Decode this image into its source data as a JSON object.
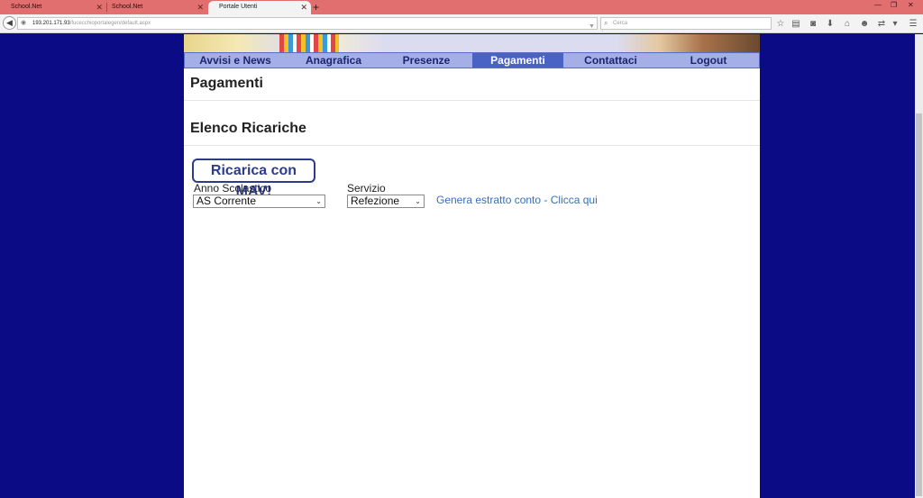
{
  "browser": {
    "tabs": [
      {
        "title": "School.Net"
      },
      {
        "title": "School.Net"
      },
      {
        "title": "Portale Utenti"
      }
    ],
    "url_host": "193.201.171.93",
    "url_path": "/fucecchioportalegen/default.aspx",
    "search_placeholder": "Cerca"
  },
  "menu": {
    "items": [
      {
        "label": "Avvisi e News"
      },
      {
        "label": "Anagrafica"
      },
      {
        "label": "Presenze"
      },
      {
        "label": "Pagamenti"
      },
      {
        "label": "Contattaci"
      },
      {
        "label": "Logout"
      }
    ],
    "active": "Pagamenti"
  },
  "page": {
    "title": "Pagamenti",
    "section_title": "Elenco Ricariche",
    "mav_button_label": "Ricarica con MAV!",
    "anno_label": "Anno Scolastico",
    "anno_value": "AS Corrente",
    "servizio_label": "Servizio",
    "servizio_value": "Refezione",
    "estratto_link": "Genera estratto conto - Clicca qui"
  },
  "colors": {
    "background": "#0b0b86",
    "tabbar": "#e26f6f",
    "menu_bg": "#a3afe6",
    "menu_active": "#4b62c5",
    "link": "#3a6fb6"
  }
}
